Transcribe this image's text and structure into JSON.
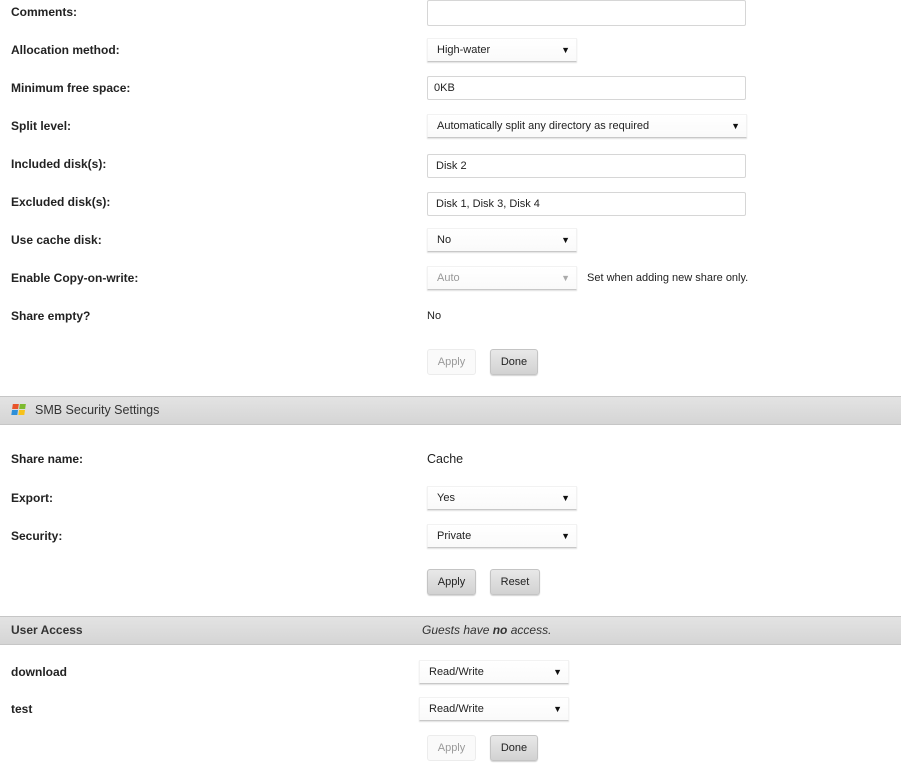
{
  "share_settings": {
    "comments": {
      "label": "Comments:",
      "value": ""
    },
    "allocation_method": {
      "label": "Allocation method:",
      "value": "High-water"
    },
    "minimum_free_space": {
      "label": "Minimum free space:",
      "value": "0KB"
    },
    "split_level": {
      "label": "Split level:",
      "value": "Automatically split any directory as required"
    },
    "included_disks": {
      "label": "Included disk(s):",
      "value": "Disk 2"
    },
    "excluded_disks": {
      "label": "Excluded disk(s):",
      "value": "Disk 1, Disk 3, Disk 4"
    },
    "use_cache_disk": {
      "label": "Use cache disk:",
      "value": "No"
    },
    "copy_on_write": {
      "label": "Enable Copy-on-write:",
      "value": "Auto",
      "note": "Set when adding new share only."
    },
    "share_empty": {
      "label": "Share empty?",
      "value": "No"
    },
    "apply_label": "Apply",
    "done_label": "Done"
  },
  "smb": {
    "title": "SMB Security Settings",
    "icon": "windows-logo-icon",
    "share_name": {
      "label": "Share name:",
      "value": "Cache"
    },
    "export": {
      "label": "Export:",
      "value": "Yes"
    },
    "security": {
      "label": "Security:",
      "value": "Private"
    },
    "apply_label": "Apply",
    "reset_label": "Reset"
  },
  "user_access": {
    "title": "User Access",
    "note_prefix": "Guests have ",
    "note_emphasis": "no",
    "note_suffix": " access.",
    "users": [
      {
        "name": "download",
        "access": "Read/Write"
      },
      {
        "name": "test",
        "access": "Read/Write"
      }
    ],
    "apply_label": "Apply",
    "done_label": "Done"
  },
  "colors": {
    "section_bar": "#dcdcdc",
    "disabled_text": "#9a9a9a",
    "win_red": "#e8542a",
    "win_green": "#7cba2e",
    "win_blue": "#2e8fd8",
    "win_yellow": "#f7c21a"
  }
}
